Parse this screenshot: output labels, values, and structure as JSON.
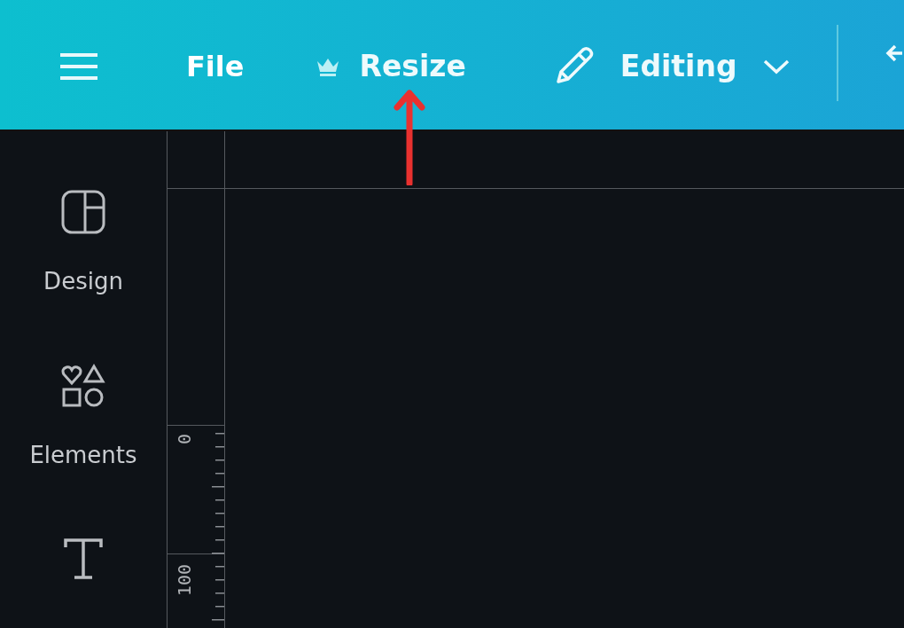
{
  "toolbar": {
    "items": [
      {
        "kind": "menu"
      },
      {
        "kind": "text",
        "label": "File"
      },
      {
        "kind": "crown",
        "label": "Resize"
      },
      {
        "kind": "dropdown",
        "label": "Editing"
      },
      {
        "kind": "divider"
      },
      {
        "kind": "undo"
      }
    ]
  },
  "sidebar": {
    "items": [
      {
        "kind": "design",
        "label": "Design"
      },
      {
        "kind": "elements",
        "label": "Elements"
      },
      {
        "kind": "text"
      }
    ]
  },
  "ruler": {
    "labels": [
      "0",
      "100"
    ]
  },
  "annotation": {
    "kind": "arrow"
  }
}
